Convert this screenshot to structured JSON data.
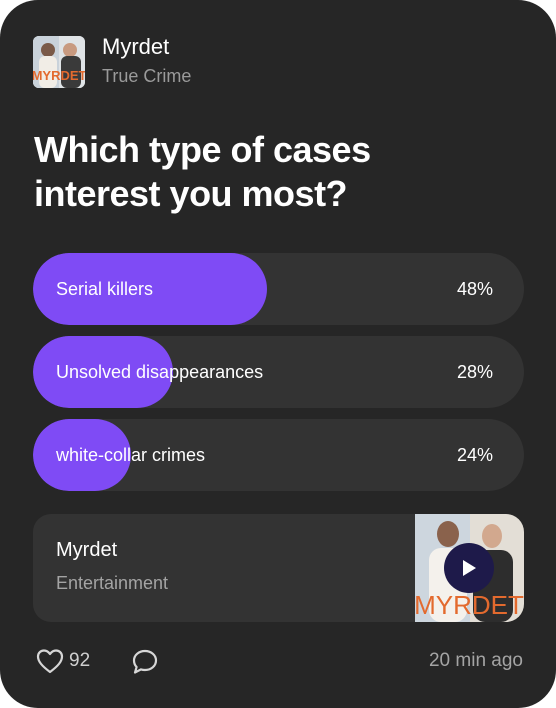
{
  "header": {
    "title": "Myrdet",
    "category": "True Crime",
    "avatar_icon": "podcast-cover-icon"
  },
  "poll": {
    "question": "Which type of cases interest you most?",
    "accent_color": "#7f4bf5",
    "options": [
      {
        "label": "Serial killers",
        "percent_text": "48%",
        "percent": 48
      },
      {
        "label": "Unsolved disappearances",
        "percent_text": "28%",
        "percent": 28
      },
      {
        "label": "white-collar crimes",
        "percent_text": "24%",
        "percent": 24
      }
    ]
  },
  "episode": {
    "title": "Myrdet",
    "subtitle": "Entertainment",
    "thumb_icon": "podcast-cover-icon",
    "play_icon": "play-icon",
    "cover_text": "MYRDET"
  },
  "footer": {
    "like_icon": "heart-icon",
    "likes": "92",
    "comment_icon": "comment-icon",
    "timestamp": "20 min ago"
  }
}
